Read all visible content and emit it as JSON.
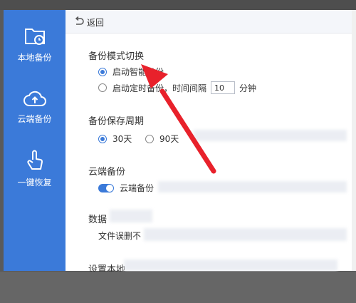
{
  "sidebar": {
    "items": [
      {
        "label": "本地备份",
        "icon": "folder-clock-icon"
      },
      {
        "label": "云端备份",
        "icon": "cloud-upload-icon"
      },
      {
        "label": "一键恢复",
        "icon": "hand-tap-icon"
      }
    ]
  },
  "backbar": {
    "label": "返回",
    "icon": "back-arrow-icon"
  },
  "mode_section": {
    "title": "备份模式切换",
    "smart_label": "启动智能备份",
    "timed_label": "启动定时备份，时间间隔",
    "interval_value": "10",
    "unit_label": "分钟"
  },
  "period_section": {
    "title": "备份保存周期",
    "opt_30": "30天",
    "opt_90": "90天"
  },
  "cloud_section": {
    "title": "云端备份",
    "toggle_label": "云端备份"
  },
  "data_section": {
    "title": "数据",
    "sub_label": "文件误删",
    "sub_trail": "不"
  },
  "setup_section": {
    "title": "设置本地"
  },
  "annotation": {
    "color": "#e8212b"
  }
}
